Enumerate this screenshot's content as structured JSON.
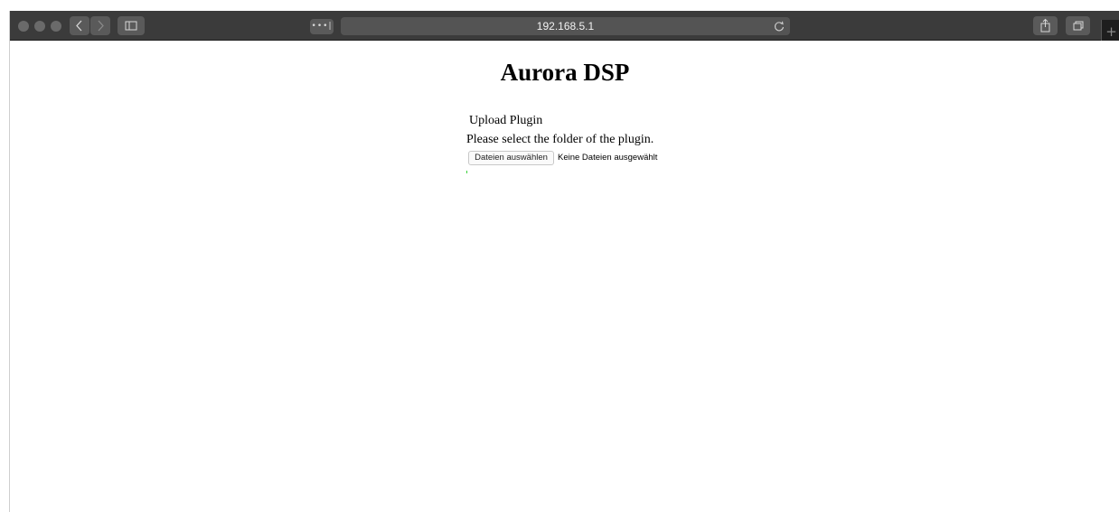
{
  "browser": {
    "url": "192.168.5.1",
    "reader_label": "•••|",
    "new_tab_label": "+"
  },
  "page": {
    "title": "Aurora DSP",
    "section_heading": "Upload Plugin",
    "instruction": "Please select the folder of the plugin.",
    "file_button_label": "Dateien auswählen",
    "file_status": "Keine Dateien ausgewählt",
    "upload_progress_percent": 0.5,
    "progress_color": "#3ad13a"
  },
  "colors": {
    "toolbar": "#3b3b3b",
    "urlbar": "#545454",
    "background": "#ffffff"
  },
  "icons": [
    "close-dot-icon",
    "minimize-dot-icon",
    "zoom-dot-icon",
    "back-icon",
    "forward-icon",
    "sidebar-icon",
    "reload-icon",
    "share-icon",
    "tabs-icon",
    "plus-icon"
  ]
}
